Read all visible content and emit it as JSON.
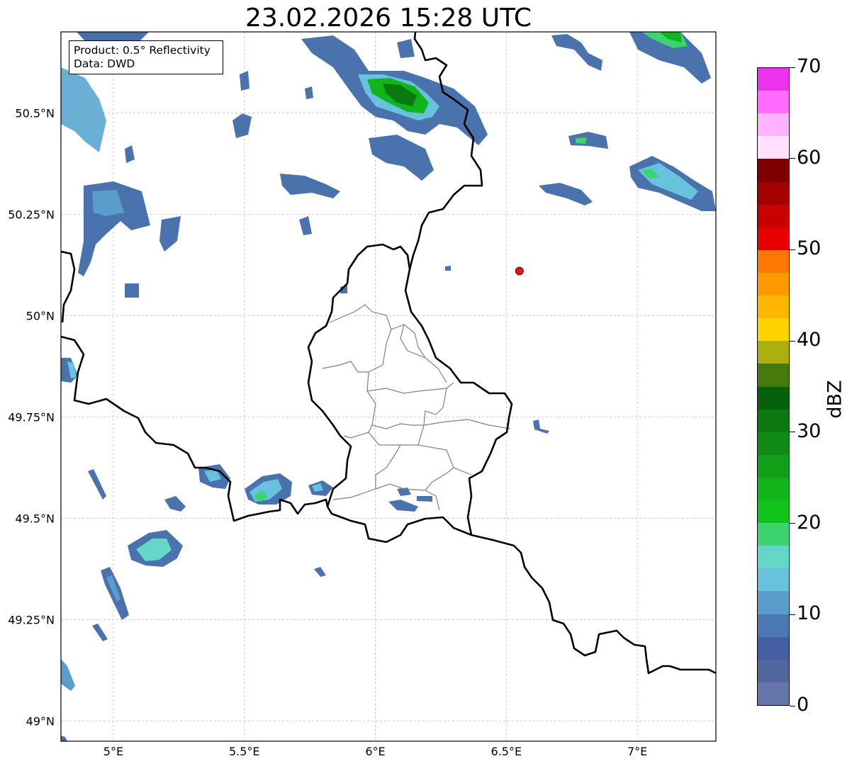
{
  "title": "23.02.2026 15:28 UTC",
  "info": {
    "product": "Product: 0.5° Reflectivity",
    "data": "Data: DWD"
  },
  "map": {
    "lon_range": [
      4.8,
      7.3
    ],
    "lat_range": [
      48.95,
      50.7
    ],
    "x_ticks": [
      {
        "value": 5.0,
        "label": "5°E"
      },
      {
        "value": 5.5,
        "label": "5.5°E"
      },
      {
        "value": 6.0,
        "label": "6°E"
      },
      {
        "value": 6.5,
        "label": "6.5°E"
      },
      {
        "value": 7.0,
        "label": "7°E"
      }
    ],
    "y_ticks": [
      {
        "value": 50.5,
        "label": "50.5°N"
      },
      {
        "value": 50.25,
        "label": "50.25°N"
      },
      {
        "value": 50.0,
        "label": "50°N"
      },
      {
        "value": 49.75,
        "label": "49.75°N"
      },
      {
        "value": 49.5,
        "label": "49.5°N"
      },
      {
        "value": 49.25,
        "label": "49.25°N"
      },
      {
        "value": 49.0,
        "label": "49°N"
      }
    ],
    "grid": true,
    "marker": {
      "lon": 6.55,
      "lat": 50.11,
      "color": "#ee1111"
    }
  },
  "colorbar": {
    "unit": "dBZ",
    "min": 0,
    "max": 70,
    "tick_labels": [
      "0",
      "10",
      "20",
      "30",
      "40",
      "50",
      "60",
      "70"
    ],
    "colors": [
      "#6776a8",
      "#53679f",
      "#435fa1",
      "#4a78b0",
      "#5a9ccb",
      "#66c2dd",
      "#66d6c8",
      "#3dd46f",
      "#11c41c",
      "#11b41b",
      "#119f19",
      "#0f8a14",
      "#0b7812",
      "#06600c",
      "#467b0c",
      "#abb00e",
      "#fdd300",
      "#feb600",
      "#fe9900",
      "#fe7700",
      "#e80000",
      "#c90000",
      "#a30000",
      "#7e0000",
      "#ffe1ff",
      "#ffb3ff",
      "#ff6cff",
      "#ec34ed"
    ]
  }
}
